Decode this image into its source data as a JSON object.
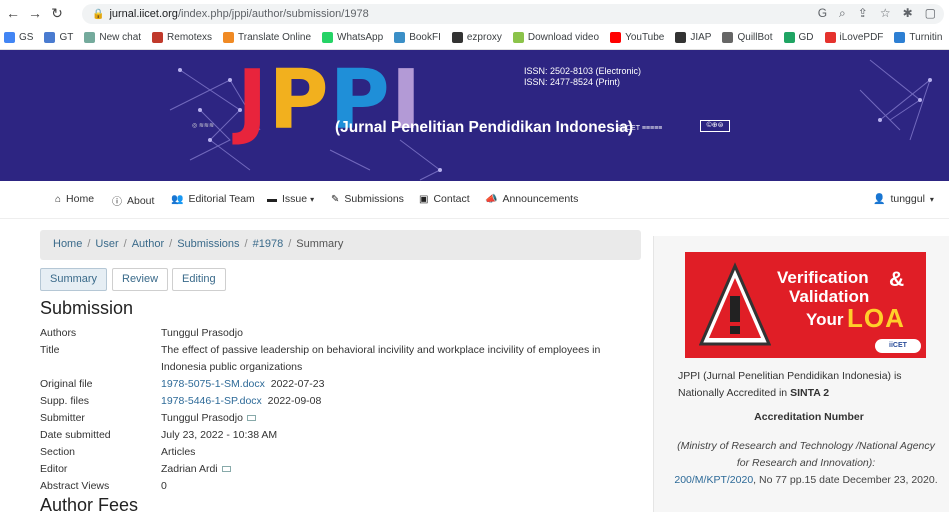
{
  "browser": {
    "url_host": "jurnal.iicet.org",
    "url_path": "/index.php/jppi/author/submission/1978"
  },
  "bookmarks": [
    {
      "label": "GS",
      "color": "#4285f4"
    },
    {
      "label": "GT",
      "color": "#4a7bd0"
    },
    {
      "label": "New chat",
      "color": "#74aa9c"
    },
    {
      "label": "Remotexs",
      "color": "#c0392b"
    },
    {
      "label": "Translate Online",
      "color": "#f08a24"
    },
    {
      "label": "WhatsApp",
      "color": "#25d366"
    },
    {
      "label": "BookFI",
      "color": "#3b8fc7"
    },
    {
      "label": "ezproxy",
      "color": "#333333"
    },
    {
      "label": "Download video",
      "color": "#8bc34a"
    },
    {
      "label": "YouTube",
      "color": "#ff0000"
    },
    {
      "label": "JIAP",
      "color": "#333333"
    },
    {
      "label": "QuillBot",
      "color": "#666666"
    },
    {
      "label": "GD",
      "color": "#1fa463"
    },
    {
      "label": "iLovePDF",
      "color": "#e5322d"
    },
    {
      "label": "Turnitin",
      "color": "#2d7fd3"
    }
  ],
  "banner": {
    "logo": [
      "J",
      "P",
      "P",
      "I"
    ],
    "logo_colors": [
      "#e8243c",
      "#f2b01e",
      "#1f8fd8",
      "#b39ad6"
    ],
    "issn_electronic": "ISSN: 2502-8103  (Electronic)",
    "issn_print": "ISSN: 2477-8524  (Print)",
    "journal_name": "(Jurnal Penelitian Pendidikan Indonesia)",
    "publisher_small": "IICET",
    "background_color": "#2d2582"
  },
  "nav": {
    "home": "Home",
    "about": "About",
    "editorial_team": "Editorial Team",
    "issue": "Issue",
    "submissions": "Submissions",
    "contact": "Contact",
    "announcements": "Announcements",
    "user": "tunggul"
  },
  "breadcrumb": [
    "Home",
    "User",
    "Author",
    "Submissions",
    "#1978",
    "Summary"
  ],
  "tabs": {
    "summary": "Summary",
    "review": "Review",
    "editing": "Editing"
  },
  "submission": {
    "heading": "Submission",
    "rows": {
      "authors_label": "Authors",
      "authors": "Tunggul Prasodjo",
      "title_label": "Title",
      "title_line1": "The effect of passive leadership on behavioral incivility and workplace incivility of employees in",
      "title_line2": "Indonesia public organizations",
      "original_file_label": "Original file",
      "original_file": "1978-5075-1-SM.docx",
      "original_file_date": "2022-07-23",
      "supp_files_label": "Supp. files",
      "supp_files": "1978-5446-1-SP.docx",
      "supp_files_date": "2022-09-08",
      "submitter_label": "Submitter",
      "submitter": "Tunggul Prasodjo",
      "date_submitted_label": "Date submitted",
      "date_submitted": "July 23, 2022 - 10:38 AM",
      "section_label": "Section",
      "section": "Articles",
      "editor_label": "Editor",
      "editor": "Zadrian Ardi",
      "abstract_views_label": "Abstract Views",
      "abstract_views": "0"
    }
  },
  "author_fees_heading": "Author Fees",
  "sidebar": {
    "loa": {
      "line1": "Verification",
      "amp": "&",
      "line2": "Validation",
      "your": "Your",
      "big": "LOA",
      "badge": "iiCET"
    },
    "accredited_text": "JPPI (Jurnal Penelitian Pendidikan Indonesia) is Nationally Accredited in ",
    "accredited_bold": "SINTA 2",
    "accreditation_heading": "Accreditation Number",
    "ministry": "(Ministry of Research and Technology /National Agency for Research and Innovation):",
    "decree_link": "200/M/KPT/2020",
    "decree_rest": ", No 77 pp.15 date December 23, 2020."
  }
}
